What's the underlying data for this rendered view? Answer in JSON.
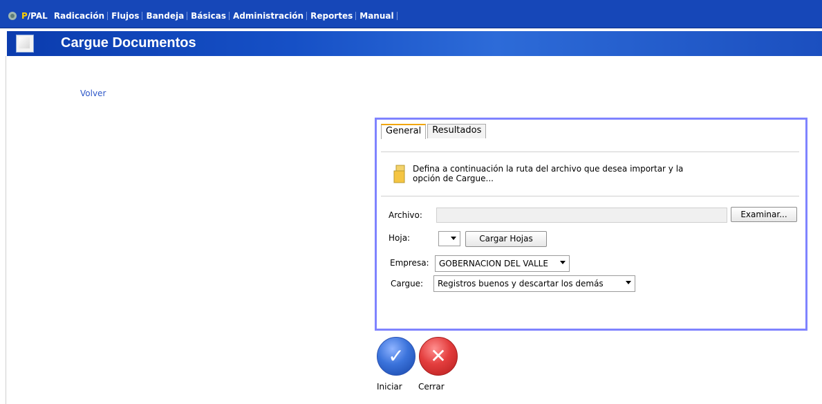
{
  "menu": {
    "brand_p": "P",
    "brand_rest": "/PAL",
    "items": [
      "Radicación",
      "Flujos",
      "Bandeja",
      "Básicas",
      "Administración",
      "Reportes",
      "Manual"
    ]
  },
  "header": {
    "title": "Cargue Documentos"
  },
  "nav": {
    "back_label": "Volver"
  },
  "tabs": {
    "general": "General",
    "results": "Resultados"
  },
  "instructions": {
    "text": "Defina a continuación la ruta del archivo que desea importar y la opción de Cargue..."
  },
  "form": {
    "archivo_label": "Archivo:",
    "archivo_value": "",
    "examinar_label": "Examinar...",
    "hoja_label": "Hoja:",
    "hoja_value": "",
    "cargar_hojas_label": "Cargar Hojas",
    "empresa_label": "Empresa:",
    "empresa_value": "GOBERNACION DEL VALLE",
    "cargue_label": "Cargue:",
    "cargue_value": "Registros buenos y descartar los demás"
  },
  "actions": {
    "iniciar_label": "Iniciar",
    "cerrar_label": "Cerrar"
  },
  "colors": {
    "brand_blue": "#1647b8",
    "panel_border": "#7f83ff",
    "tab_accent": "#f2a500",
    "link_blue": "#2c56c8"
  }
}
